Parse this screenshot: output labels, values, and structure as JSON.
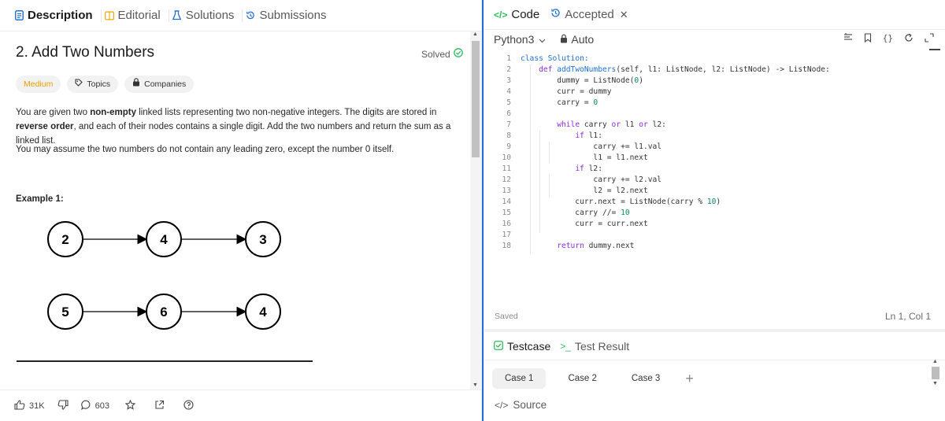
{
  "left_tabs": {
    "description": "Description",
    "editorial": "Editorial",
    "solutions": "Solutions",
    "submissions": "Submissions"
  },
  "problem": {
    "title": "2. Add Two Numbers",
    "solved_label": "Solved",
    "tags": {
      "difficulty": "Medium",
      "topics": "Topics",
      "companies": "Companies"
    },
    "desc_part1": "You are given two ",
    "desc_bold1": "non-empty",
    "desc_part2": " linked lists representing two non-negative integers. The digits are stored in ",
    "desc_bold2": "reverse order",
    "desc_part3": ", and each of their nodes contains a single digit. Add the two numbers and return the sum as a linked list.",
    "desc2": "You may assume the two numbers do not contain any leading zero, except the number 0 itself.",
    "example_title": "Example 1:",
    "list1": [
      "2",
      "4",
      "3"
    ],
    "list2": [
      "5",
      "6",
      "4"
    ]
  },
  "footer": {
    "likes": "31K",
    "comments": "603"
  },
  "code_tabs": {
    "code": "Code",
    "accepted": "Accepted"
  },
  "toolbar": {
    "language": "Python3",
    "auto": "Auto"
  },
  "code_lines": [
    "class Solution:",
    "    def addTwoNumbers(self, l1: ListNode, l2: ListNode) -> ListNode:",
    "        dummy = ListNode(0)",
    "        curr = dummy",
    "        carry = 0",
    "",
    "        while carry or l1 or l2:",
    "            if l1:",
    "                carry += l1.val",
    "                l1 = l1.next",
    "            if l2:",
    "                carry += l2.val",
    "                l2 = l2.next",
    "            curr.next = ListNode(carry % 10)",
    "            carry //= 10",
    "            curr = curr.next",
    "",
    "        return dummy.next"
  ],
  "status": {
    "saved": "Saved",
    "cursor": "Ln 1, Col 1"
  },
  "bottom_tabs": {
    "testcase": "Testcase",
    "test_result": "Test Result"
  },
  "cases": [
    "Case 1",
    "Case 2",
    "Case 3"
  ],
  "plus": "+",
  "source": "Source",
  "colors": {
    "accent_blue": "#1f6fd6",
    "medium": "#e7a000",
    "green": "#2cbb5d"
  }
}
